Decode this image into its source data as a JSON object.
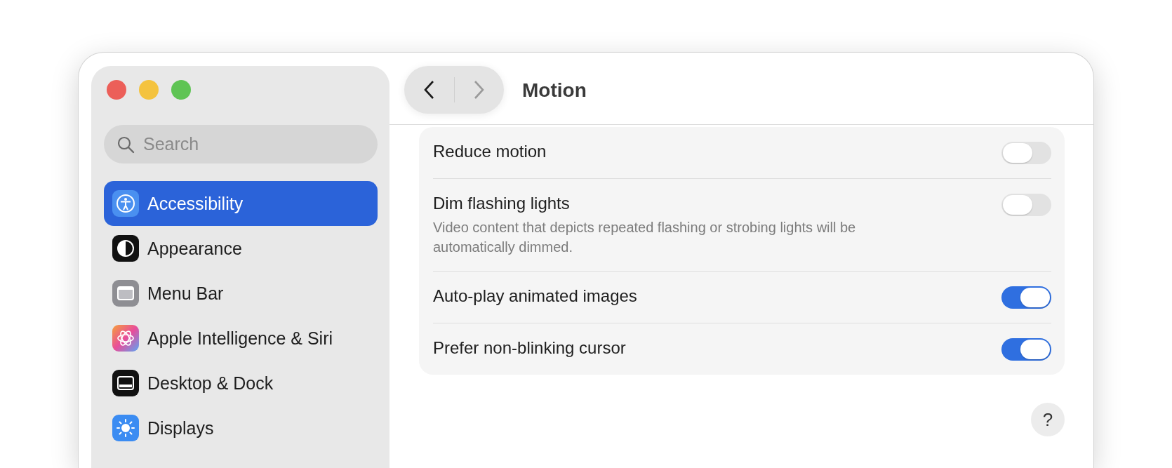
{
  "sidebar": {
    "search": {
      "placeholder": "Search"
    },
    "items": [
      {
        "label": "Accessibility",
        "selected": true
      },
      {
        "label": "Appearance",
        "selected": false
      },
      {
        "label": "Menu Bar",
        "selected": false
      },
      {
        "label": "Apple Intelligence & Siri",
        "selected": false
      },
      {
        "label": "Desktop & Dock",
        "selected": false
      },
      {
        "label": "Displays",
        "selected": false
      }
    ]
  },
  "header": {
    "title": "Motion",
    "nav": [
      {
        "kind": "back",
        "disabled": false
      },
      {
        "kind": "forward",
        "disabled": true
      }
    ]
  },
  "settings": [
    {
      "label": "Reduce motion",
      "on": false
    },
    {
      "label": "Dim flashing lights",
      "description": "Video content that depicts repeated flashing or strobing lights will be automatically dimmed.",
      "on": false
    },
    {
      "label": "Auto-play animated images",
      "on": true
    },
    {
      "label": "Prefer non-blinking cursor",
      "on": true
    }
  ],
  "help": {
    "label": "?"
  }
}
